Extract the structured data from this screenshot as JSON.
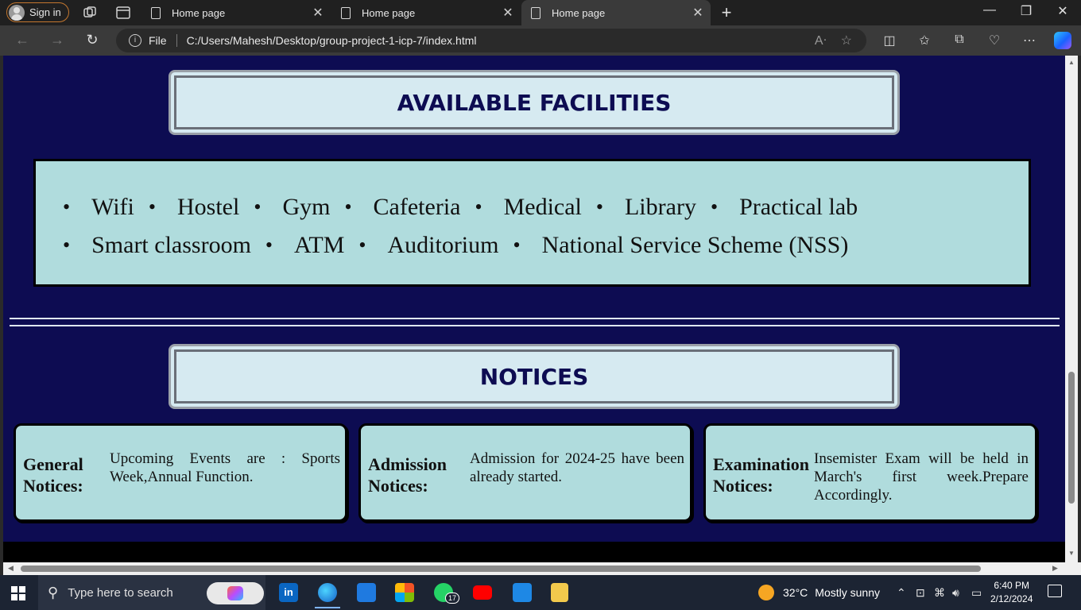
{
  "browser": {
    "sign_in_label": "Sign in",
    "tabs": [
      {
        "title": "Home page",
        "active": false
      },
      {
        "title": "Home page",
        "active": false
      },
      {
        "title": "Home page",
        "active": true
      }
    ],
    "address": {
      "scheme_label": "File",
      "url": "C:/Users/Mahesh/Desktop/group-project-1-icp-7/index.html"
    }
  },
  "page": {
    "facilities_heading": "AVAILABLE FACILITIES",
    "facilities": [
      "Wifi",
      "Hostel",
      "Gym",
      "Cafeteria",
      "Medical",
      "Library",
      "Practical lab",
      "Smart classroom",
      "ATM",
      "Auditorium",
      "National Service Scheme (NSS)"
    ],
    "notices_heading": "NOTICES",
    "notices": [
      {
        "title": "General Notices:",
        "text": "Upcoming Events are : Sports Week,Annual Function."
      },
      {
        "title": "Admission Notices:",
        "text": "Admission for 2024-25 have been already started."
      },
      {
        "title": "Examination Notices:",
        "text": "Insemister Exam will be held in March's first week.Prepare Accordingly."
      }
    ]
  },
  "taskbar": {
    "search_placeholder": "Type here to search",
    "whatsapp_badge": "17",
    "weather_temp": "32°C",
    "weather_text": "Mostly sunny",
    "time": "6:40 PM",
    "date": "2/12/2024"
  },
  "colors": {
    "page_background": "#0d0c52",
    "card_background": "#b0dcdd",
    "heading_background": "#d6eaf1"
  }
}
